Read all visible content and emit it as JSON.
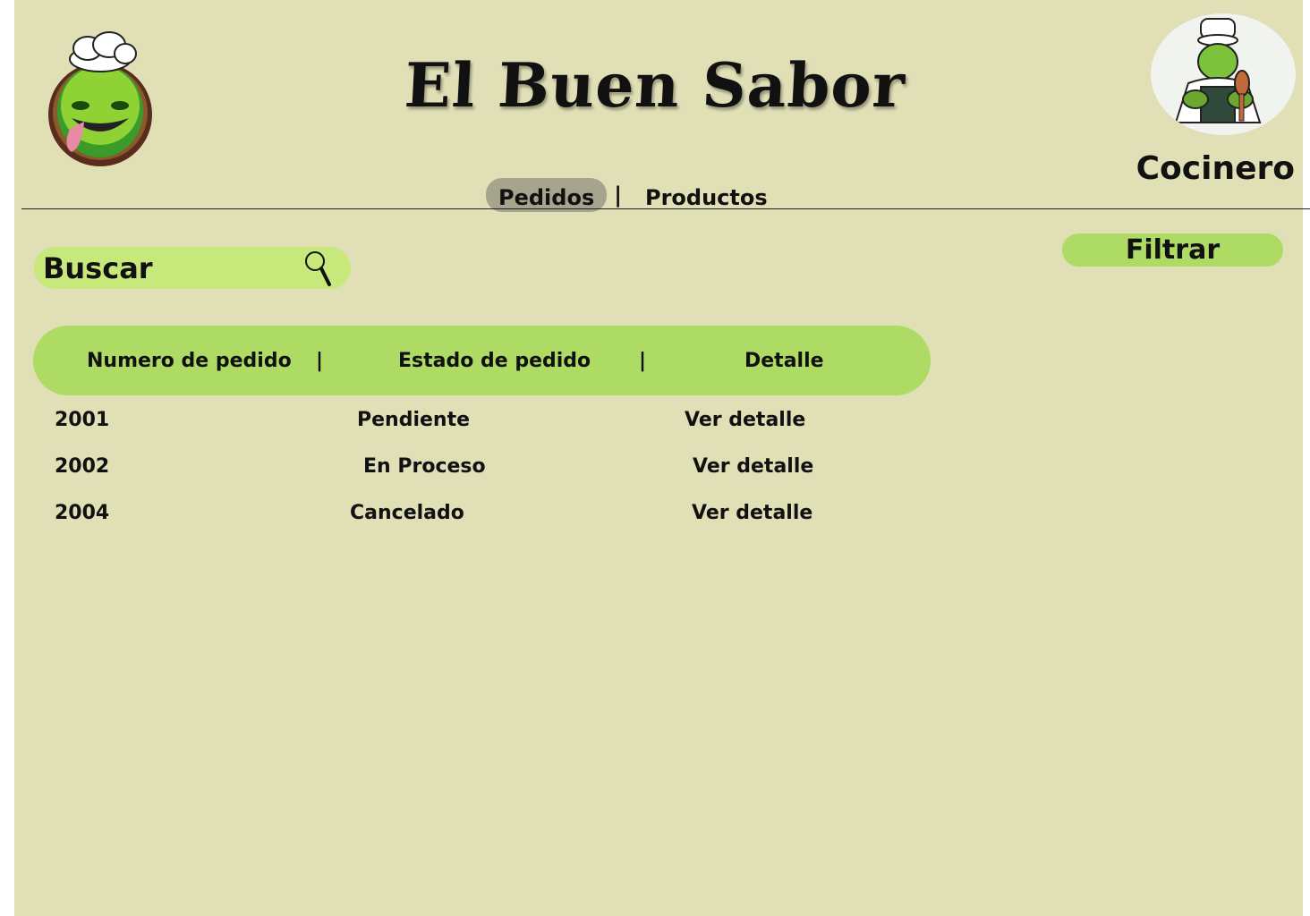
{
  "app": {
    "title": "El Buen Sabor",
    "role": "Cocinero"
  },
  "nav": {
    "tabs": [
      {
        "label": "Pedidos",
        "active": true
      },
      {
        "label": "Productos",
        "active": false
      }
    ],
    "separator": "|"
  },
  "search": {
    "label": "Buscar",
    "icon": "search-icon"
  },
  "filter": {
    "label": "Filtrar"
  },
  "table": {
    "headers": [
      "Numero de pedido",
      "Estado de pedido",
      "Detalle"
    ],
    "separator": "|",
    "rows": [
      {
        "numero": "2001",
        "estado": "Pendiente",
        "detalle": "Ver detalle"
      },
      {
        "numero": "2002",
        "estado": "En Proceso",
        "detalle": "Ver detalle"
      },
      {
        "numero": "2004",
        "estado": "Cancelado",
        "detalle": "Ver detalle"
      }
    ]
  },
  "colors": {
    "background": "#e0dfb6",
    "accent_green": "#aedb64",
    "search_green": "#c7e97b",
    "active_tab": "#a6a48c"
  }
}
